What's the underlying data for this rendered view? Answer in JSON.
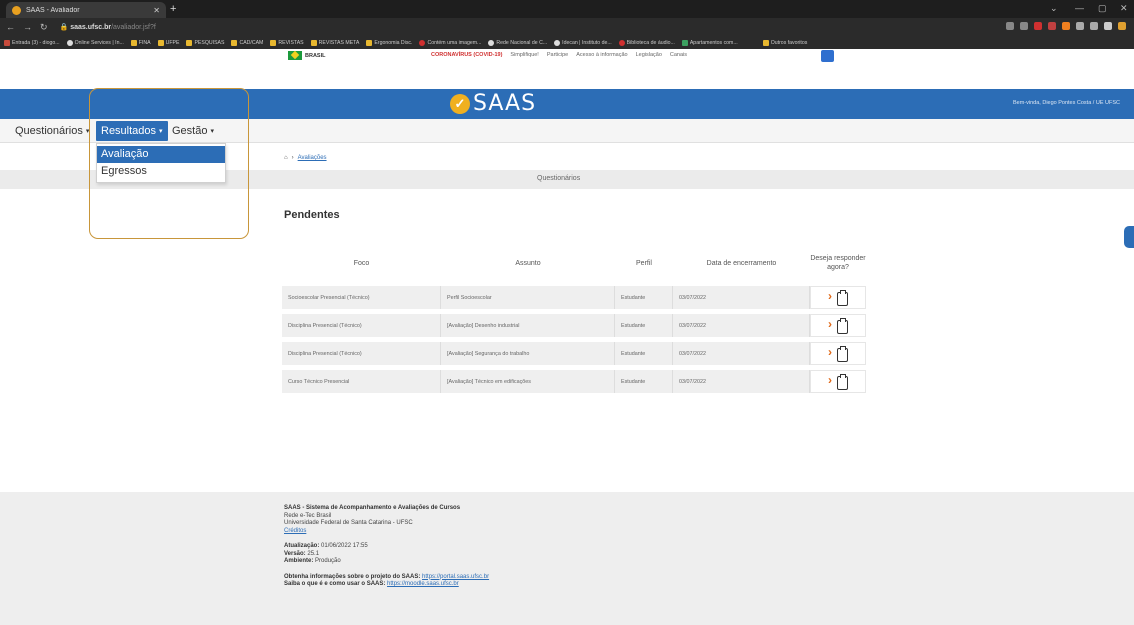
{
  "browser": {
    "tab_title": "SAAS - Avaliador",
    "url_host": "saas.ufsc.br",
    "url_path": "/avaliador.jsf?f",
    "bookmarks": [
      "Entrada (3) - diogo...",
      "Online Services | In...",
      "FINA",
      "UFPE",
      "PESQUISAS",
      "CAD/CAM",
      "REVISTAS",
      "REVISTAS META",
      "Ergonomia Disc.",
      "Contém uma imagem...",
      "Rede Nacional de C...",
      "Idecan | Instituto de...",
      "Biblioteca de áudio...",
      "Apartamentos com...",
      "Outros favoritos"
    ]
  },
  "gov": {
    "brasil": "BRASIL",
    "links": [
      "CORONAVÍRUS (COVID-19)",
      "Simplifique!",
      "Participe",
      "Acesso à informação",
      "Legislação",
      "Canais"
    ]
  },
  "header": {
    "logo": "SAAS",
    "welcome": "Bem-vinda, Diego Pontes Costa / UE UFSC"
  },
  "menu": {
    "questionarios": "Questionários",
    "resultados": "Resultados",
    "gestao": "Gestão",
    "dropdown": [
      "Avaliação",
      "Egressos"
    ]
  },
  "breadcrumb": {
    "home": "⌂",
    "sep": "›",
    "current": "Avaliações"
  },
  "section_title": "Questionários",
  "pending_title": "Pendentes",
  "table": {
    "headers": [
      "Foco",
      "Assunto",
      "Perfil",
      "Data de encerramento",
      "Deseja responder agora?"
    ],
    "rows": [
      [
        "Socioescolar Presencial (Técnico)",
        "Perfil Socioescolar",
        "Estudante",
        "03/07/2022"
      ],
      [
        "Disciplina Presencial (Técnico)",
        "[Avaliação] Desenho industrial",
        "Estudante",
        "03/07/2022"
      ],
      [
        "Disciplina Presencial (Técnico)",
        "[Avaliação] Segurança do trabalho",
        "Estudante",
        "03/07/2022"
      ],
      [
        "Curso Técnico Presencial",
        "[Avaliação] Técnico em edificações",
        "Estudante",
        "03/07/2022"
      ]
    ]
  },
  "footer": {
    "title": "SAAS - Sistema de Acompanhamento e Avaliações de Cursos",
    "line2": "Rede e-Tec Brasil",
    "line3": "Universidade Federal de Santa Catarina - UFSC",
    "creditos": "Créditos",
    "atualizacao_label": "Atualização:",
    "atualizacao": "01/06/2022 17:55",
    "versao_label": "Versão:",
    "versao": "25.1",
    "ambiente_label": "Ambiente:",
    "ambiente": "Produção",
    "info_label": "Obtenha informações sobre o projeto do SAAS:",
    "info_link": "https://portal.saas.ufsc.br",
    "saiba_label": "Saiba o que é e como usar o SAAS:",
    "saiba_link": "https://moodle.saas.ufsc.br"
  }
}
